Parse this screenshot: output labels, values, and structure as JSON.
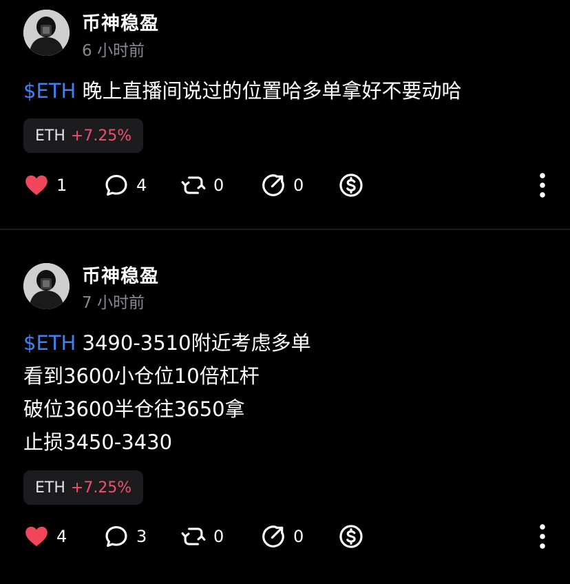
{
  "posts": [
    {
      "author": "币神稳盈",
      "time": "6 小时前",
      "cashtag": "$ETH",
      "lines": [
        "晚上直播间说过的位置哈多单拿好不要动哈"
      ],
      "ticker": {
        "symbol": "ETH",
        "change": "+7.25%"
      },
      "likes": "1",
      "comments": "4",
      "reposts": "0",
      "shares": "0"
    },
    {
      "author": "币神稳盈",
      "time": "7 小时前",
      "cashtag": "$ETH",
      "lines": [
        "3490-3510附近考虑多单",
        "看到3600小仓位10倍杠杆",
        "破位3600半仓往3650拿",
        "止损3450-3430"
      ],
      "ticker": {
        "symbol": "ETH",
        "change": "+7.25%"
      },
      "likes": "4",
      "comments": "3",
      "reposts": "0",
      "shares": "0"
    }
  ],
  "colors": {
    "background": "#000000",
    "cashtag": "#3b82f6",
    "positive_change": "#f0506e",
    "like_heart": "#ef4759",
    "muted_text": "#8a8a8e",
    "chip_bg": "#1c1c1e"
  },
  "icons": {
    "like": "heart-icon",
    "comment": "comment-bubble-icon",
    "repost": "repost-icon",
    "share": "share-icon",
    "tip": "dollar-coin-icon",
    "more": "vertical-ellipsis-icon"
  }
}
